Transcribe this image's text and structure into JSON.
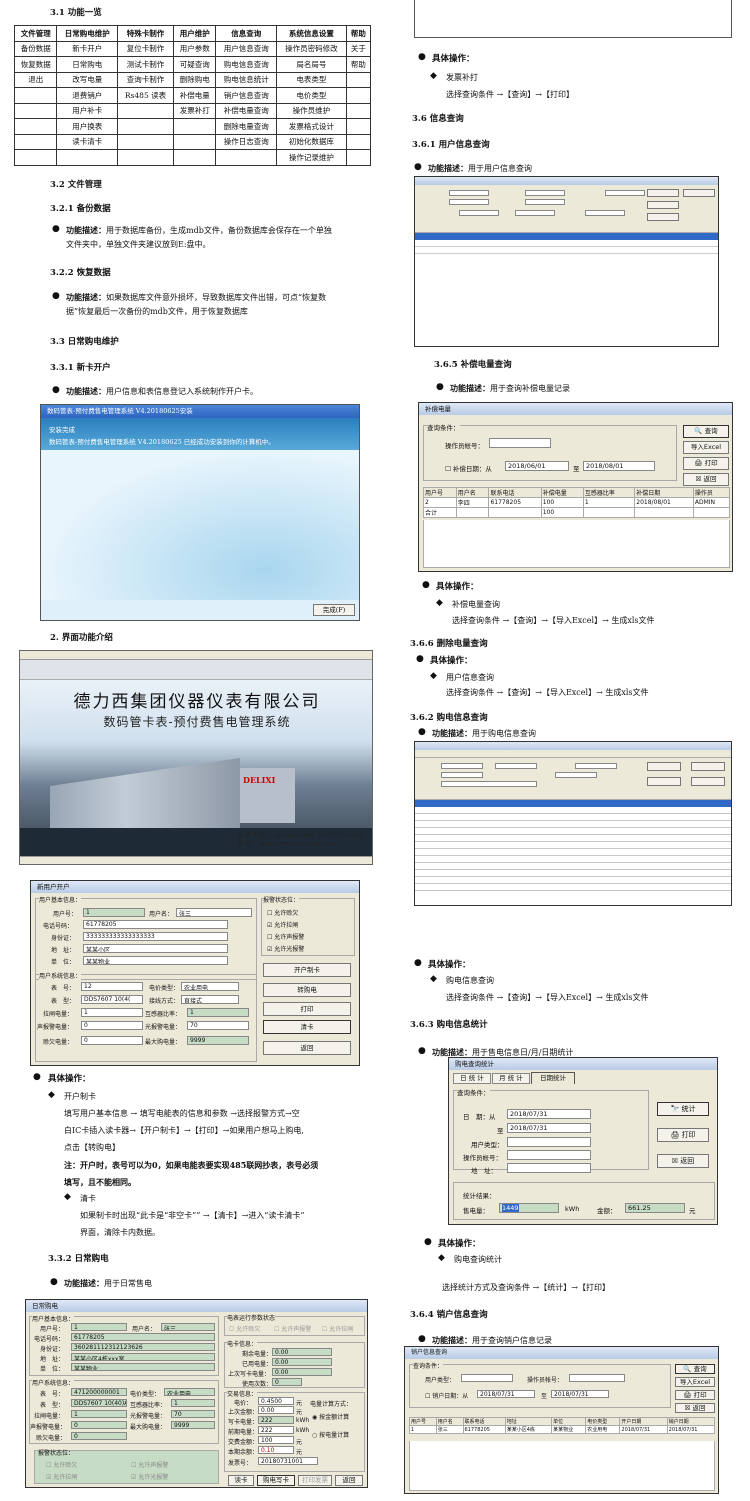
{
  "s31": {
    "heading": "3.1 功能一览",
    "headers": [
      "文件管理",
      "日常购电维护",
      "特殊卡制作",
      "用户维护",
      "信息查询",
      "系统信息设置",
      "帮助"
    ],
    "rows": [
      [
        "备份数据",
        "新卡开户",
        "复位卡制作",
        "用户参数",
        "用户信息查询",
        "操作员密码修改",
        "关于"
      ],
      [
        "恢复数据",
        "日常购电",
        "测试卡制作",
        "可疑查询",
        "购电信息查询",
        "局名局号",
        "帮助"
      ],
      [
        "退出",
        "改写电量",
        "查询卡制作",
        "删除购电",
        "购电信息统计",
        "电表类型",
        ""
      ],
      [
        "",
        "退费销户",
        "Rs485 读表",
        "补偿电量",
        "销户信息查询",
        "电价类型",
        ""
      ],
      [
        "",
        "用户补卡",
        "",
        "发票补打",
        "补偿电量查询",
        "操作员维护",
        ""
      ],
      [
        "",
        "用户换表",
        "",
        "",
        "删除电量查询",
        "发票格式设计",
        ""
      ],
      [
        "",
        "读卡清卡",
        "",
        "",
        "操作日志查询",
        "初始化数据库",
        ""
      ],
      [
        "",
        "",
        "",
        "",
        "",
        "操作记录维护",
        ""
      ]
    ]
  },
  "s32": {
    "h": "3.2 文件管理",
    "h1": "3.2.1 备份数据",
    "k1": "功能描述：",
    "t1a": "用于数据库备份，生成mdb文件，备份数据库会保存在一个单独",
    "t1b": "文件夹中，单独文件夹建议放到E:盘中。",
    "h2": "3.2.2 恢复数据",
    "k2": "功能描述：",
    "t2a": "如果数据库文件意外损坏，导致数据库文件出错，可点“恢复数",
    "t2b": "据”恢复最后一次备份的mdb文件，用于恢复数据库"
  },
  "s33": {
    "h": "3.3 日常购电维护",
    "h1": "3.3.1 新卡开户",
    "k1": "功能描述：",
    "t1": "用户信息和表信息登记入系统制作开户卡。"
  },
  "install": {
    "title": "数码管表-预付费售电管理系统 V4.20180625安装",
    "line1": "安装完成",
    "line2": "数码管表-预付费售电管理系统 V4.20180625 已经成功安装到你的计算机中。",
    "finish": "完成(F)"
  },
  "s2": {
    "h": "2.  界面功能介绍"
  },
  "splash": {
    "company": "德力西集团仪器仪表有限公司",
    "system": "数码管卡表-预付费售电管理系统",
    "sign": "DELIXI",
    "support": "技 术 支 持 ： 400 826 8008，0577-61778205",
    "site": "网 址 ： http://www.delixi-yqyb.com"
  },
  "kaihu": {
    "title": "新用户开户",
    "g1": "用户基本信息：",
    "uid_l": "用户号：",
    "uid": "1",
    "uname_l": "用户名：",
    "uname": "张三",
    "phone_l": "电话号码：",
    "phone": "61778205",
    "idc_l": "身份证：",
    "idc": "333333333333333333",
    "addr_l": "地　址：",
    "addr": "某某小区",
    "unit_l": "单　位：",
    "unit": "某某物业",
    "g2": "用户系统信息：",
    "meter_l": "表　号：",
    "meter": "12",
    "price_l": "电价类型：",
    "price": "农业用电",
    "type_l": "表　型：",
    "type": "DDS7607 10(4(",
    "wire_l": "接线方式：",
    "wire": "直接式",
    "lazha_l": "拉闸电量：",
    "lazha": "1",
    "ct_l": "互感器比率：",
    "ct": "1",
    "sound_l": "声报警电量：",
    "sound": "0",
    "light_l": "光报警电量：",
    "light": "70",
    "over_l": "赊欠电量：",
    "over": "0",
    "max_l": "最大购电量：",
    "max": "9999",
    "alarm": "报警状态位：",
    "a1": "允许赊欠",
    "a2": "允许拉闸",
    "a3": "允许声报警",
    "a4": "允许光报警",
    "b1": "开户制卡",
    "b2": "转购电",
    "b3": "打印",
    "b4": "清卡",
    "b5": "返回"
  },
  "op1": {
    "h": "具体操作：",
    "i1": "开户制卡",
    "t1": "填写用户基本信息 → 填写电能表的信息和参数 →选择报警方式→空",
    "t2": "白IC卡插入读卡器→【开户制卡】→【打印】→如果用户想马上购电,",
    "t3": "点击【转购电】",
    "n1": "注：开户时，表号可以为0，如果电能表要实现485联网抄表，表号必须",
    "n2": "填写，且不能相同。",
    "i2": "清卡",
    "t4": "如果制卡时出现“此卡是“非空卡”” →【清卡】→进入“读卡清卡”",
    "t5": "界面，清除卡内数据。"
  },
  "s332": {
    "h": "3.3.2 日常购电",
    "k": "功能描述：",
    "t": "用于日常售电"
  },
  "goudian": {
    "title": "日常购电",
    "g1": "用户基本信息：",
    "uid_l": "用户号：",
    "uid": "1",
    "uname_l": "用户名：",
    "uname": "张三",
    "phone_l": "电话号码：",
    "phone": "61778205",
    "idc_l": "身份证：",
    "idc": "360281112312123626",
    "addr_l": "地　址：",
    "addr": "某某小区4栋xxx室",
    "unit_l": "单　位：",
    "unit": "某某物业",
    "g2": "用户系统信息：",
    "meter_l": "表　号：",
    "meter": "471200000001",
    "price_l": "电价类型：",
    "price": "农业用电",
    "type_l": "表　型：",
    "type": "DDS7607 10(40)A",
    "ct_l": "互感器比率：",
    "ct": "1",
    "lazha_l": "拉闸电量：",
    "lazha": "1",
    "light_l": "光报警电量：",
    "light": "70",
    "sound_l": "声报警电量：",
    "sound": "0",
    "max_l": "最大购电量：",
    "max": "9999",
    "over_l": "赊欠电量：",
    "over": "0",
    "alarm": "报警状态位：",
    "c1": "允许赊欠",
    "c2": "允许声报警",
    "c3": "允许拉闸",
    "c4": "允许光报警",
    "mg": "电表运行参数状态",
    "m1": "允许赊欠",
    "m2": "允许声报警",
    "m3": "允许拉闸",
    "eg": "电卡信息：",
    "rem_l": "剩余电量：",
    "rem": "0.00",
    "used_l": "已用电量：",
    "used": "0.00",
    "last_l": "上次写卡电量：",
    "last": "0.00",
    "cnt_l": "使用次数：",
    "cnt": "0",
    "tg": "交易信息：",
    "pr_l": "电价：",
    "pr": "0.4500",
    "pr_u": "元",
    "lastb_l": "上次金额：",
    "lastb": "0.00",
    "lastb_u": "元",
    "wk_l": "写卡电量：",
    "wk": "222",
    "wk_u": "kWh",
    "buy_l": "前期电量：",
    "buy": "222",
    "buy_u": "kWh",
    "money_l": "交费金额：",
    "money": "100",
    "money_u": "元",
    "ret_l": "本期余额：",
    "ret": "0.10",
    "ret_u": "元",
    "inv_l": "发票号：",
    "inv": "20180731001",
    "mode": "电量计算方式：",
    "r1": "按金额计算",
    "r2": "按电量计算",
    "b1": "读卡",
    "b2": "购电写卡",
    "b3": "打印发票",
    "b4": "返回"
  },
  "r_top": {
    "h": "具体操作：",
    "i": "发票补打",
    "t": "选择查询条件 →【查询】→【打印】"
  },
  "s36": {
    "h": "3.6 信息查询",
    "h1": "3.6.1 用户信息查询",
    "k": "功能描述：",
    "t": "用于用户信息查询"
  },
  "s365": {
    "h": "3.6.5 补偿电量查询",
    "k": "功能描述：",
    "t": "用于查询补偿电量记录"
  },
  "buchang": {
    "title": "补偿电量",
    "q": "查询条件：",
    "op_l": "操作员帐号：",
    "chk": "补偿日期：从",
    "d1": "2018/06/01",
    "to": "至",
    "d2": "2018/08/01",
    "b1": "查询",
    "b2": "导入Excel",
    "b3": "打印",
    "b4": "返回",
    "cols": [
      "用户号",
      "用户名",
      "联系电话",
      "补偿电量",
      "互感器比率",
      "补偿日期",
      "操作员"
    ],
    "row1": [
      "2",
      "李四",
      "61778205",
      "100",
      "1",
      "2018/08/01",
      "ADMIN"
    ],
    "row2": [
      "合计",
      "",
      "",
      "100",
      "",
      "",
      ""
    ]
  },
  "op365": {
    "h": "具体操作：",
    "i": "补偿电量查询",
    "t": "选择查询条件 →【查询】→【导入Excel】→ 生成xls文件"
  },
  "s366": {
    "h": "3.6.6 删除电量查询",
    "op": "具体操作：",
    "i": "用户信息查询",
    "t": "选择查询条件 →【查询】→【导入Excel】→ 生成xls文件"
  },
  "s362": {
    "h": "3.6.2 购电信息查询",
    "k": "功能描述：",
    "t": "用于购电信息查询"
  },
  "op362": {
    "h": "具体操作：",
    "i": "购电信息查询",
    "t": "选择查询条件 →【查询】→【导入Excel】→ 生成xls文件"
  },
  "s363": {
    "h": "3.6.3 购电信息统计",
    "k": "功能描述：",
    "t": "用于售电信息日/月/日期统计"
  },
  "tongji": {
    "title": "购电查询统计",
    "tab1": "日 统 计",
    "tab2": "月 统 计",
    "tab3": "日期统计",
    "q": "查询条件：",
    "d_l": "日　期：从",
    "d1": "2018/07/31",
    "to": "至",
    "d2": "2018/07/31",
    "ut_l": "用户类型：",
    "op_l": "操作员帐号：",
    "addr_l": "地　址：",
    "b1": "统计",
    "b2": "打印",
    "b3": "返回",
    "res": "统计结果：",
    "e_l": "售电量：",
    "e": "1449",
    "e_u": "kWh",
    "m_l": "金额：",
    "m": "661.25",
    "m_u": "元"
  },
  "op363": {
    "h": "具体操作：",
    "i": "购电查询统计",
    "t": "选择统计方式及查询条件 →【统计】→【打印】"
  },
  "s364": {
    "h": "3.6.4 销户信息查询",
    "k": "功能描述：",
    "t": "用于查询销户信息记录"
  },
  "xiaohu": {
    "title": "销户信息查询",
    "q": "查询条件：",
    "ut_l": "用户类型：",
    "op_l": "操作员帐号：",
    "chk": "销户日期：从",
    "d1": "2018/07/31",
    "to": "至",
    "d2": "2018/07/31",
    "b1": "查询",
    "b2": "导入Excel",
    "b3": "打印",
    "b4": "返回",
    "cols": [
      "用户号",
      "用户名",
      "联系电话",
      "地址",
      "单位",
      "电价类型",
      "开户日期",
      "销户日期"
    ],
    "row1": [
      "1",
      "张三",
      "61778205",
      "某某小区4栋",
      "某某物业",
      "农业用电",
      "2018/07/31",
      "2018/07/31"
    ]
  }
}
